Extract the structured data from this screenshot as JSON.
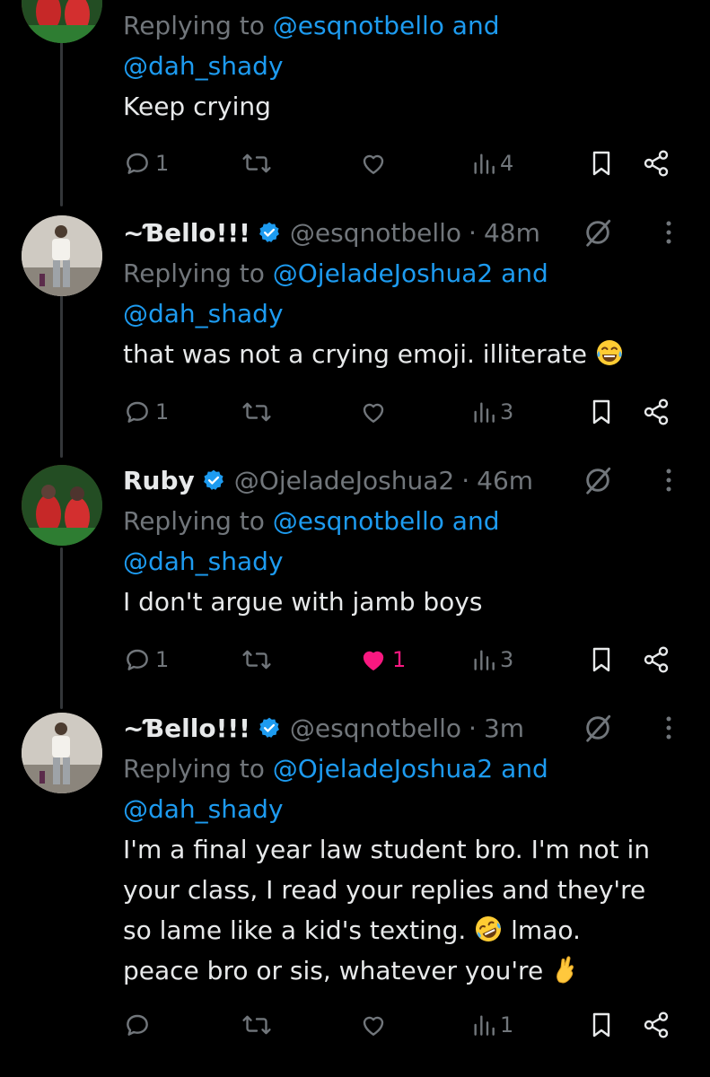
{
  "tweets": [
    {
      "replying_prefix": "Replying to ",
      "replying_mention1": "@esqnotbello",
      "replying_and": " and",
      "replying_mention2": "@dah_shady",
      "text": "Keep crying",
      "stats": {
        "replies": "1",
        "retweets": "",
        "likes": "",
        "views": "4"
      }
    },
    {
      "name": "~Ɓello!!!",
      "handle": "@esqnotbello",
      "time": "48m",
      "replying_prefix": "Replying to ",
      "replying_mention1": "@OjeladeJoshua2",
      "replying_and": " and",
      "replying_mention2": "@dah_shady",
      "text": "that was not a crying emoji. illiterate",
      "stats": {
        "replies": "1",
        "retweets": "",
        "likes": "",
        "views": "3"
      }
    },
    {
      "name": "Ruby",
      "handle": "@OjeladeJoshua2",
      "time": "46m",
      "replying_prefix": "Replying to ",
      "replying_mention1": "@esqnotbello",
      "replying_and": " and",
      "replying_mention2": "@dah_shady",
      "text": "I don't argue with jamb boys",
      "stats": {
        "replies": "1",
        "retweets": "",
        "likes": "1",
        "views": "3"
      }
    },
    {
      "name": "~Ɓello!!!",
      "handle": "@esqnotbello",
      "time": "3m",
      "replying_prefix": "Replying to ",
      "replying_mention1": "@OjeladeJoshua2",
      "replying_and": " and",
      "replying_mention2": "@dah_shady",
      "text_line1": "I'm a final year law student bro. I'm not in",
      "text_line2": "your class, I read your replies and they're",
      "text_line3a": "so lame like a kid's texting.",
      "text_line3b": " lmao.",
      "text_line4": "peace bro or sis, whatever you're",
      "stats": {
        "replies": "",
        "retweets": "",
        "likes": "",
        "views": "1"
      }
    }
  ],
  "colors": {
    "background": "#000000",
    "text": "#e7e9ea",
    "secondary": "#71767b",
    "link": "#1d9bf0",
    "verified": "#1d9bf0",
    "like_active": "#f91880"
  },
  "icons": [
    "reply-icon",
    "retweet-icon",
    "like-icon",
    "views-icon",
    "bookmark-icon",
    "share-icon",
    "grok-icon",
    "more-icon",
    "verified-badge-icon"
  ]
}
